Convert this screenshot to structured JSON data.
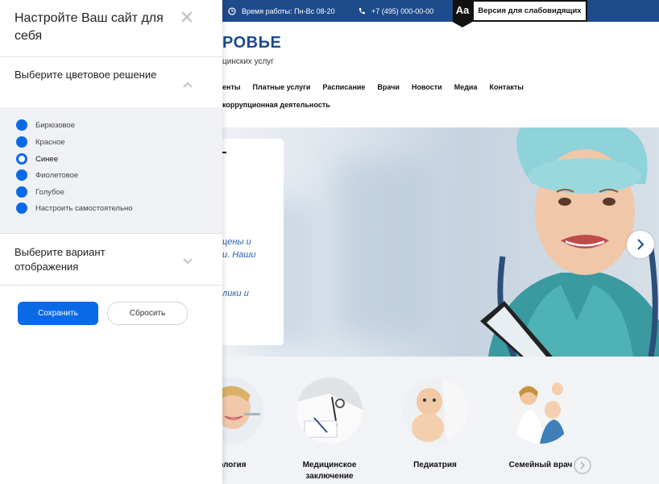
{
  "site": {
    "topbar": {
      "hours": "Время работы: Пн-Вс 08-20",
      "phone": "+7 (495) 000-00-00",
      "aa": "Aa",
      "vision_label": "Версия для слабовидящих"
    },
    "logo": {
      "title": "РОВЬЕ",
      "subtitle": "цинских услуг"
    },
    "nav_primary": [
      "енты",
      "Платные услуги",
      "Расписание",
      "Врачи",
      "Новости",
      "Медиа",
      "Контакты"
    ],
    "nav_secondary": [
      "коррупционная деятельность"
    ],
    "hero": {
      "card_lines": [
        "цены и",
        "и. Наши",
        "лики и"
      ]
    },
    "services": [
      "тология",
      "Медицинское заключение",
      "Педиатрия",
      "Семейный врач"
    ]
  },
  "panel": {
    "title": "Настройте Ваш сайт для себя",
    "color_section": {
      "title": "Выберите цветовое решение",
      "options": [
        "Бирюзовое",
        "Красное",
        "Синее",
        "Фиолетовое",
        "Голубое",
        "Настроить самостоятельно"
      ],
      "selected": "Синее"
    },
    "display_section": {
      "title": "Выберите вариант отображения"
    },
    "save_label": "Сохранить",
    "reset_label": "Сбросить"
  },
  "colors": {
    "accent": "#0a6ae6",
    "topbar": "#1d4b8c",
    "option_bg": "#eff1f4"
  }
}
